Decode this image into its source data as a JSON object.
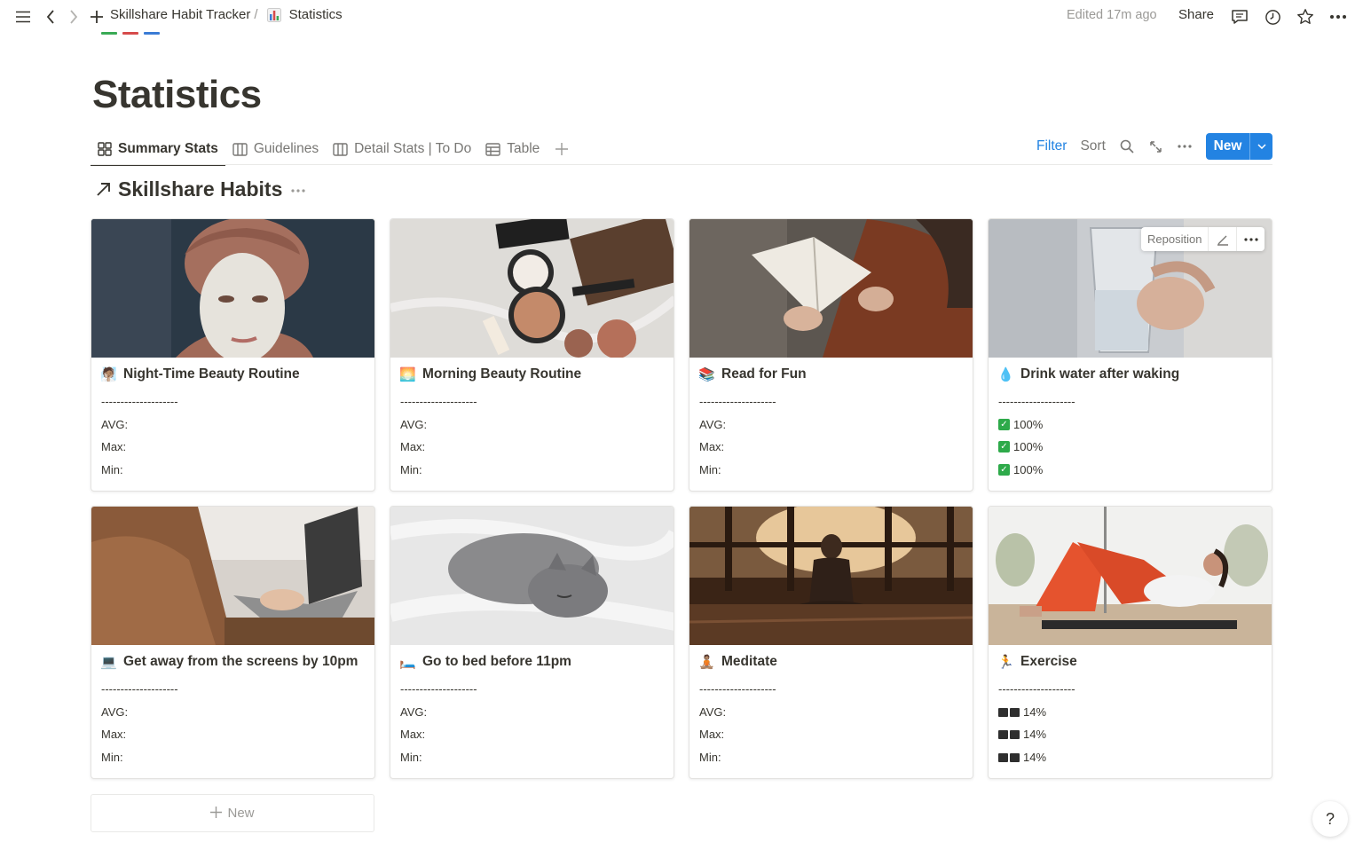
{
  "breadcrumb": {
    "workspace": "Skillshare Habit Tracker",
    "separator": "/",
    "page": "Statistics"
  },
  "header": {
    "edited": "Edited 17m ago",
    "share": "Share"
  },
  "page": {
    "title": "Statistics"
  },
  "tabs": [
    {
      "label": "Summary Stats",
      "icon": "gallery-icon"
    },
    {
      "label": "Guidelines",
      "icon": "board-icon"
    },
    {
      "label": "Detail Stats | To Do",
      "icon": "board-icon"
    },
    {
      "label": "Table",
      "icon": "table-icon"
    }
  ],
  "toolbar": {
    "filter": "Filter",
    "sort": "Sort",
    "new": "New"
  },
  "section": {
    "title": "Skillshare Habits"
  },
  "cards": [
    {
      "emoji": "🧖🏽",
      "title": "Night-Time Beauty Routine",
      "divider": "--------------------",
      "lines": [
        "AVG:",
        "Max:",
        "Min:"
      ]
    },
    {
      "emoji": "🌅",
      "title": "Morning Beauty Routine",
      "divider": "--------------------",
      "lines": [
        "AVG:",
        "Max:",
        "Min:"
      ]
    },
    {
      "emoji": "📚",
      "title": "Read for Fun",
      "divider": "--------------------",
      "lines": [
        "AVG:",
        "Max:",
        "Min:"
      ]
    },
    {
      "emoji": "💧",
      "title": "Drink water after waking",
      "divider": "--------------------",
      "lines": [
        "100%",
        "100%",
        "100%"
      ]
    },
    {
      "emoji": "💻",
      "title": "Get away from the screens by 10pm",
      "divider": "--------------------",
      "lines": [
        "AVG:",
        "Max:",
        "Min:"
      ]
    },
    {
      "emoji": "🛏️",
      "title": "Go to bed before 11pm",
      "divider": "--------------------",
      "lines": [
        "AVG:",
        "Max:",
        "Min:"
      ]
    },
    {
      "emoji": "🧘🏽",
      "title": "Meditate",
      "divider": "--------------------",
      "lines": [
        "AVG:",
        "Max:",
        "Min:"
      ]
    },
    {
      "emoji": "🏃",
      "title": "Exercise",
      "divider": "--------------------",
      "lines": [
        "14%",
        "14%",
        "14%"
      ]
    }
  ],
  "cover_menu": {
    "reposition": "Reposition"
  },
  "add_new": "New",
  "help": "?"
}
